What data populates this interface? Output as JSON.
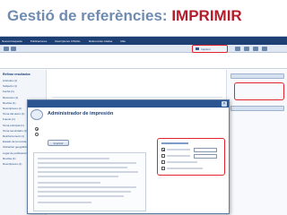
{
  "slide": {
    "title_prefix": "Gestió de referències: ",
    "title_accent": "IMPRIMIR",
    "accent_color": "#b21d2b",
    "title_color": "#6f8bb0"
  },
  "screenshot": {
    "top_nav": [
      "Nueva búsqueda",
      "Publicaciones",
      "Descriptores CINAHL",
      "Referencias citadas",
      "Más"
    ],
    "toolbar": {
      "print_label": "Imprimir",
      "print_icon": "printer-icon"
    },
    "sidebar": {
      "heading": "Refinar resultados",
      "items": [
        "Artículos (1)",
        "Subjects (1)",
        "Fecha (1)",
        "Recursos (1)",
        "Revista (1)",
        "Descriptores (1)",
        "Tema del autor (1)",
        "Fuente (1)",
        "Tema principal (1)",
        "Tema secundario (1)",
        "Reinforcement (1)",
        "Estado de la revista (1)",
        "Ubicación geográfica (1)",
        "Lugar de publicación (1)",
        "Revista (1)",
        "Descriptores (1)"
      ]
    },
    "dialog": {
      "title": "Administrador de impresión",
      "print_button": "Imprimir",
      "print_icon": "printer-icon",
      "close_icon": "close-icon"
    },
    "colors": {
      "nav_bar": "#1d3f73",
      "highlight": "#e3232e",
      "link": "#1d57a8"
    }
  }
}
